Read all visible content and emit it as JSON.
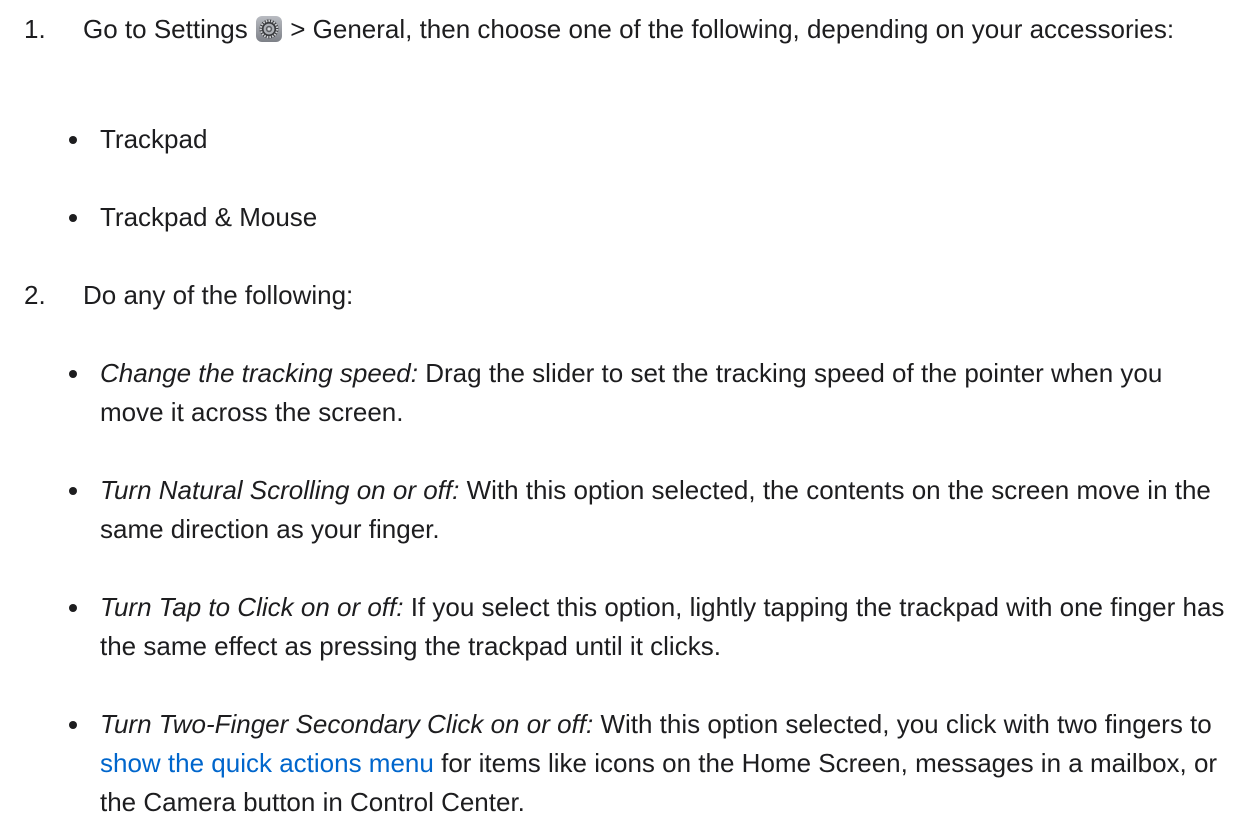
{
  "steps": [
    {
      "number": "1.",
      "text_before_icon": "Go to Settings",
      "icon": "settings-gear-icon",
      "text_after_icon": "> General, then choose one of the following, depending on your accessories:",
      "bullets": [
        {
          "text": "Trackpad"
        },
        {
          "text": "Trackpad & Mouse"
        }
      ]
    },
    {
      "number": "2.",
      "text": "Do any of the following:",
      "bullets": [
        {
          "label": "Change the tracking speed:",
          "text": "Drag the slider to set the tracking speed of the pointer when you move it across the screen."
        },
        {
          "label": "Turn Natural Scrolling on or off:",
          "text": "With this option selected, the contents on the screen move in the same direction as your finger."
        },
        {
          "label": "Turn Tap to Click on or off:",
          "text": "If you select this option, lightly tapping the trackpad with one finger has the same effect as pressing the trackpad until it clicks."
        },
        {
          "label": "Turn Two-Finger Secondary Click on or off:",
          "text_before_link": "With this option selected, you click with two fingers to",
          "link": "show the quick actions menu",
          "text_after_link": "for items like icons on the Home Screen, messages in a mailbox, or the Camera button in Control Center."
        }
      ]
    }
  ],
  "colors": {
    "text": "#1d1d1f",
    "link": "#0066cc"
  }
}
